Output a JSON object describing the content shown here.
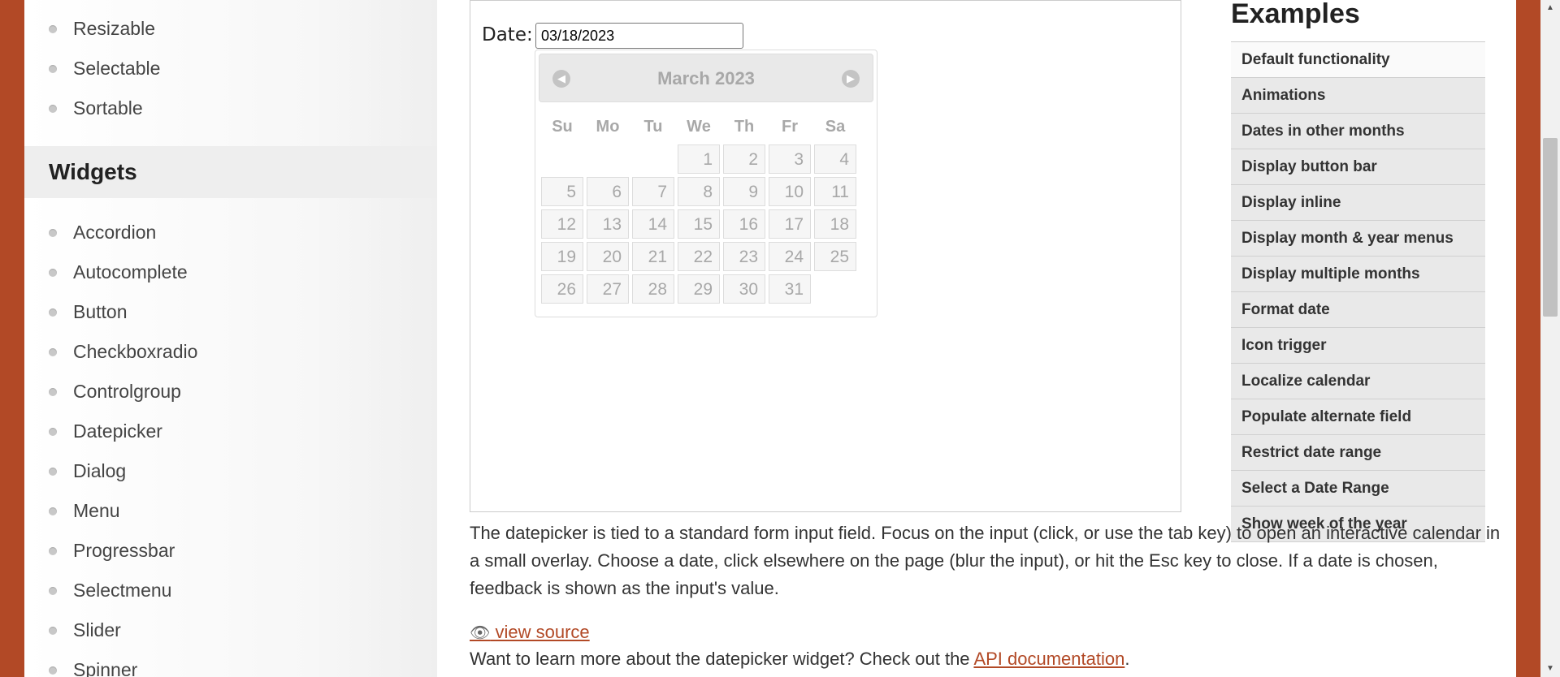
{
  "sidebar": {
    "interactions": [
      "Resizable",
      "Selectable",
      "Sortable"
    ],
    "widgets_heading": "Widgets",
    "widgets": [
      "Accordion",
      "Autocomplete",
      "Button",
      "Checkboxradio",
      "Controlgroup",
      "Datepicker",
      "Dialog",
      "Menu",
      "Progressbar",
      "Selectmenu",
      "Slider",
      "Spinner"
    ]
  },
  "demo": {
    "date_label": "Date:",
    "date_value": "03/18/2023",
    "calendar": {
      "title": "March 2023",
      "prev_icon": "circle-triangle-left-icon",
      "next_icon": "circle-triangle-right-icon",
      "weekdays": [
        "Su",
        "Mo",
        "Tu",
        "We",
        "Th",
        "Fr",
        "Sa"
      ],
      "weeks": [
        [
          "",
          "",
          "",
          "1",
          "2",
          "3",
          "4"
        ],
        [
          "5",
          "6",
          "7",
          "8",
          "9",
          "10",
          "11"
        ],
        [
          "12",
          "13",
          "14",
          "15",
          "16",
          "17",
          "18"
        ],
        [
          "19",
          "20",
          "21",
          "22",
          "23",
          "24",
          "25"
        ],
        [
          "26",
          "27",
          "28",
          "29",
          "30",
          "31",
          ""
        ]
      ]
    }
  },
  "examples": {
    "title": "Examples",
    "items": [
      "Default functionality",
      "Animations",
      "Dates in other months",
      "Display button bar",
      "Display inline",
      "Display month & year menus",
      "Display multiple months",
      "Format date",
      "Icon trigger",
      "Localize calendar",
      "Populate alternate field",
      "Restrict date range",
      "Select a Date Range",
      "Show week of the year"
    ]
  },
  "description": "The datepicker is tied to a standard form input field. Focus on the input (click, or use the tab key) to open an interactive calendar in a small overlay. Choose a date, click elsewhere on the page (blur the input), or hit the Esc key to close. If a date is chosen, feedback is shown as the input's value.",
  "view_source": {
    "icon": "eye-icon",
    "label": "view source"
  },
  "more_info": {
    "prefix": "Want to learn more about the datepicker widget? Check out the ",
    "link": "API documentation",
    "suffix": "."
  },
  "colors": {
    "brand": "#b24926",
    "link": "#b24926"
  }
}
